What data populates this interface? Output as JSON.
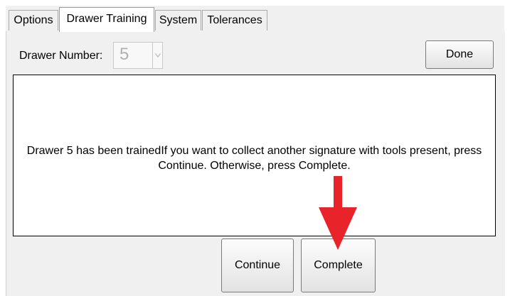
{
  "tabs": [
    {
      "label": "Options",
      "active": false
    },
    {
      "label": "Drawer Training",
      "active": true
    },
    {
      "label": "System",
      "active": false
    },
    {
      "label": "Tolerances",
      "active": false
    }
  ],
  "drawer": {
    "label": "Drawer Number:",
    "value": "5"
  },
  "buttons": {
    "done": "Done",
    "continue": "Continue",
    "complete": "Complete"
  },
  "message": "Drawer 5 has been trainedIf you want to collect another signature with tools present, press\nContinue.  Otherwise, press Complete.",
  "icons": {
    "select_arrow": "chevron-down-icon",
    "annotation": "red-arrow-down-icon"
  },
  "colors": {
    "annotation_arrow": "#e8232a",
    "panel_bg": "#f0f0f0"
  }
}
